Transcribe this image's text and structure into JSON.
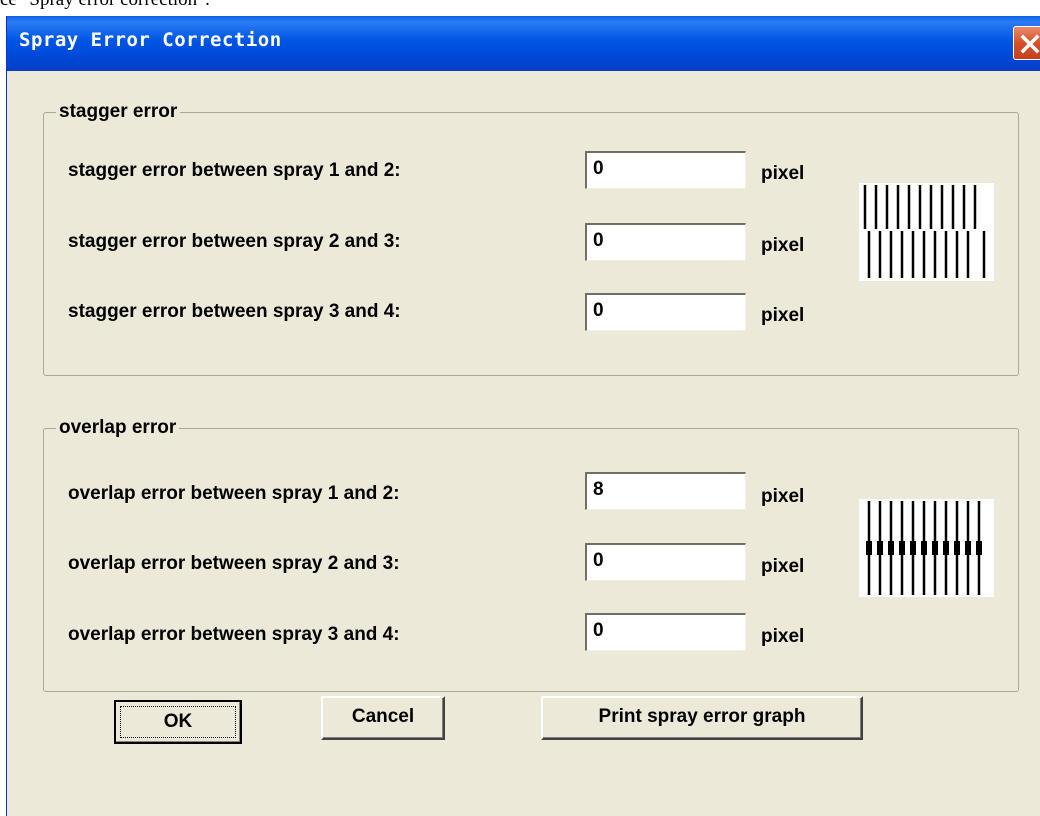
{
  "doc_fragment": "ce \"Spray error correction\":",
  "dialog": {
    "title": "Spray Error Correction",
    "close_icon": "close-x-icon"
  },
  "stagger": {
    "legend": "stagger error",
    "rows": [
      {
        "label": "stagger error between spray 1 and 2:",
        "value": "0",
        "unit": "pixel"
      },
      {
        "label": "stagger error between spray 2 and 3:",
        "value": "0",
        "unit": "pixel"
      },
      {
        "label": "stagger error between spray 3 and 4:",
        "value": "0",
        "unit": "pixel"
      }
    ],
    "graph_icon": "stagger-pattern-icon"
  },
  "overlap": {
    "legend": "overlap error",
    "rows": [
      {
        "label": "overlap error between spray 1 and 2:",
        "value": "8",
        "unit": "pixel"
      },
      {
        "label": "overlap error between spray 2 and 3:",
        "value": "0",
        "unit": "pixel"
      },
      {
        "label": "overlap error between spray 3 and 4:",
        "value": "0",
        "unit": "pixel"
      }
    ],
    "graph_icon": "overlap-pattern-icon"
  },
  "buttons": {
    "ok": "OK",
    "cancel": "Cancel",
    "print": "Print spray error graph"
  }
}
